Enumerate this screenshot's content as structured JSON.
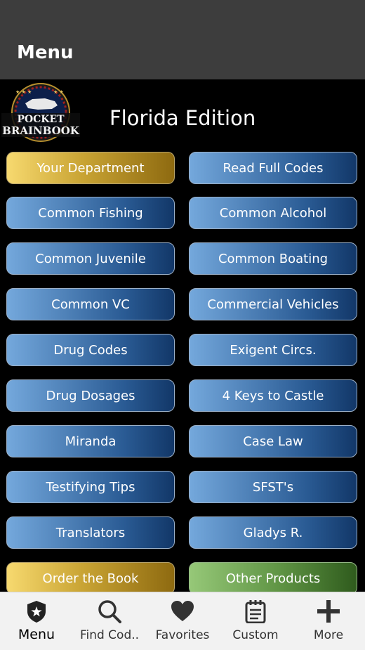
{
  "header": {
    "title": "Menu"
  },
  "brand": {
    "logo_text_top": "POCKET",
    "logo_text_bottom": "BRAINBOOK",
    "edition": "Florida Edition"
  },
  "menu": {
    "items": [
      {
        "label": "Your Department",
        "style": "gold"
      },
      {
        "label": "Read Full Codes",
        "style": "blue"
      },
      {
        "label": "Common Fishing",
        "style": "blue"
      },
      {
        "label": "Common Alcohol",
        "style": "blue"
      },
      {
        "label": "Common Juvenile",
        "style": "blue"
      },
      {
        "label": "Common Boating",
        "style": "blue"
      },
      {
        "label": "Common VC",
        "style": "blue"
      },
      {
        "label": "Commercial Vehicles",
        "style": "blue"
      },
      {
        "label": "Drug Codes",
        "style": "blue"
      },
      {
        "label": "Exigent Circs.",
        "style": "blue"
      },
      {
        "label": "Drug Dosages",
        "style": "blue"
      },
      {
        "label": "4 Keys to Castle",
        "style": "blue"
      },
      {
        "label": "Miranda",
        "style": "blue"
      },
      {
        "label": "Case Law",
        "style": "blue"
      },
      {
        "label": "Testifying Tips",
        "style": "blue"
      },
      {
        "label": "SFST's",
        "style": "blue"
      },
      {
        "label": "Translators",
        "style": "blue"
      },
      {
        "label": "Gladys R.",
        "style": "blue"
      },
      {
        "label": "Order the Book",
        "style": "gold"
      },
      {
        "label": "Other Products",
        "style": "green"
      }
    ]
  },
  "tabbar": {
    "tabs": [
      {
        "label": "Menu",
        "icon": "badge-icon",
        "active": true
      },
      {
        "label": "Find Cod..",
        "icon": "search-icon",
        "active": false
      },
      {
        "label": "Favorites",
        "icon": "heart-icon",
        "active": false
      },
      {
        "label": "Custom",
        "icon": "notepad-icon",
        "active": false
      },
      {
        "label": "More",
        "icon": "plus-icon",
        "active": false
      }
    ]
  },
  "colors": {
    "header_bg": "#3d3d3d",
    "body_bg": "#000000",
    "button_blue": "#2a5b94",
    "button_gold": "#c9a434",
    "button_green": "#5e9343"
  }
}
